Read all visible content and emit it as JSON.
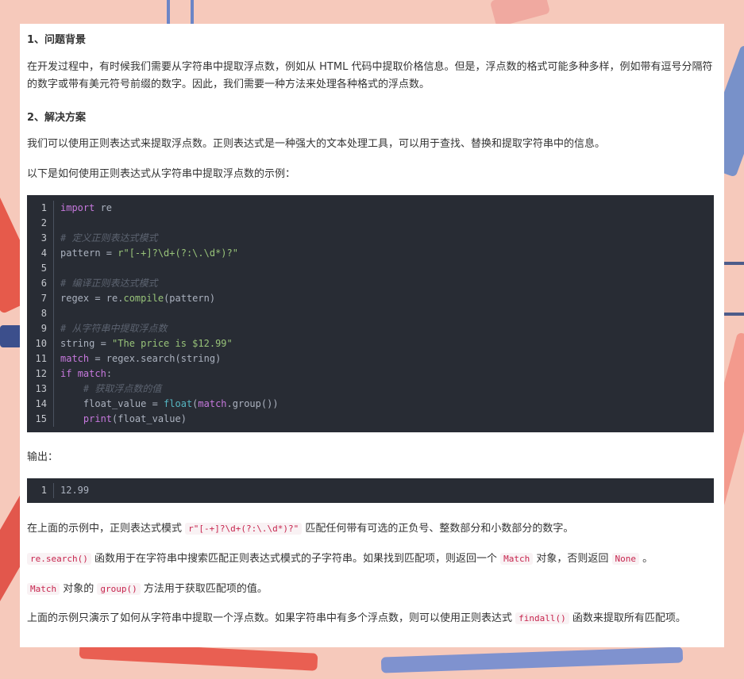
{
  "section1": {
    "heading": "1、问题背景",
    "paragraph": "在开发过程中，有时候我们需要从字符串中提取浮点数，例如从 HTML 代码中提取价格信息。但是，浮点数的格式可能多种多样，例如带有逗号分隔符的数字或带有美元符号前缀的数字。因此，我们需要一种方法来处理各种格式的浮点数。"
  },
  "section2": {
    "heading": "2、解决方案",
    "paragraph1": "我们可以使用正则表达式来提取浮点数。正则表达式是一种强大的文本处理工具，可以用于查找、替换和提取字符串中的信息。",
    "paragraph2": "以下是如何使用正则表达式从字符串中提取浮点数的示例："
  },
  "code": {
    "line_numbers": [
      "1",
      "2",
      "3",
      "4",
      "5",
      "6",
      "7",
      "8",
      "9",
      "10",
      "11",
      "12",
      "13",
      "14",
      "15"
    ],
    "lines": [
      [
        {
          "t": "import",
          "c": "kw"
        },
        {
          "t": " re",
          "c": ""
        }
      ],
      [],
      [
        {
          "t": "# 定义正则表达式模式",
          "c": "cm"
        }
      ],
      [
        {
          "t": "pattern = ",
          "c": ""
        },
        {
          "t": "r\"[-+]?\\d+(?:\\.\\d*)?\"",
          "c": "str"
        }
      ],
      [],
      [
        {
          "t": "# 编译正则表达式模式",
          "c": "cm"
        }
      ],
      [
        {
          "t": "regex = re.",
          "c": ""
        },
        {
          "t": "compile",
          "c": "fc"
        },
        {
          "t": "(pattern)",
          "c": ""
        }
      ],
      [],
      [
        {
          "t": "# 从字符串中提取浮点数",
          "c": "cm"
        }
      ],
      [
        {
          "t": "string = ",
          "c": ""
        },
        {
          "t": "\"The price is $12.99\"",
          "c": "str"
        }
      ],
      [
        {
          "t": "match",
          "c": "kw"
        },
        {
          "t": " = regex.search(string)",
          "c": ""
        }
      ],
      [
        {
          "t": "if",
          "c": "kw"
        },
        {
          "t": " ",
          "c": ""
        },
        {
          "t": "match",
          "c": "kw"
        },
        {
          "t": ":",
          "c": ""
        }
      ],
      [
        {
          "t": "    ",
          "c": ""
        },
        {
          "t": "# 获取浮点数的值",
          "c": "cm"
        }
      ],
      [
        {
          "t": "    float_value = ",
          "c": ""
        },
        {
          "t": "float",
          "c": "bi"
        },
        {
          "t": "(",
          "c": ""
        },
        {
          "t": "match",
          "c": "kw"
        },
        {
          "t": ".group())",
          "c": ""
        }
      ],
      [
        {
          "t": "    ",
          "c": ""
        },
        {
          "t": "print",
          "c": "kw"
        },
        {
          "t": "(float_value)",
          "c": ""
        }
      ]
    ]
  },
  "output": {
    "label": "输出：",
    "line_number": "1",
    "value": "12.99"
  },
  "explanation": {
    "p1_before": "在上面的示例中，正则表达式模式 ",
    "p1_code": "r\"[-+]?\\d+(?:\\.\\d*)?\"",
    "p1_after": " 匹配任何带有可选的正负号、整数部分和小数部分的数字。",
    "p2_code1": "re.search()",
    "p2_mid": " 函数用于在字符串中搜索匹配正则表达式模式的子字符串。如果找到匹配项，则返回一个 ",
    "p2_code2": "Match",
    "p2_mid2": " 对象，否则返回 ",
    "p2_code3": "None",
    "p2_end": " 。",
    "p3_code1": "Match",
    "p3_mid": " 对象的 ",
    "p3_code2": "group()",
    "p3_end": " 方法用于获取匹配项的值。",
    "p4_before": "上面的示例只演示了如何从字符串中提取一个浮点数。如果字符串中有多个浮点数，则可以使用正则表达式 ",
    "p4_code": "findall()",
    "p4_after": " 函数来提取所有匹配项。"
  }
}
